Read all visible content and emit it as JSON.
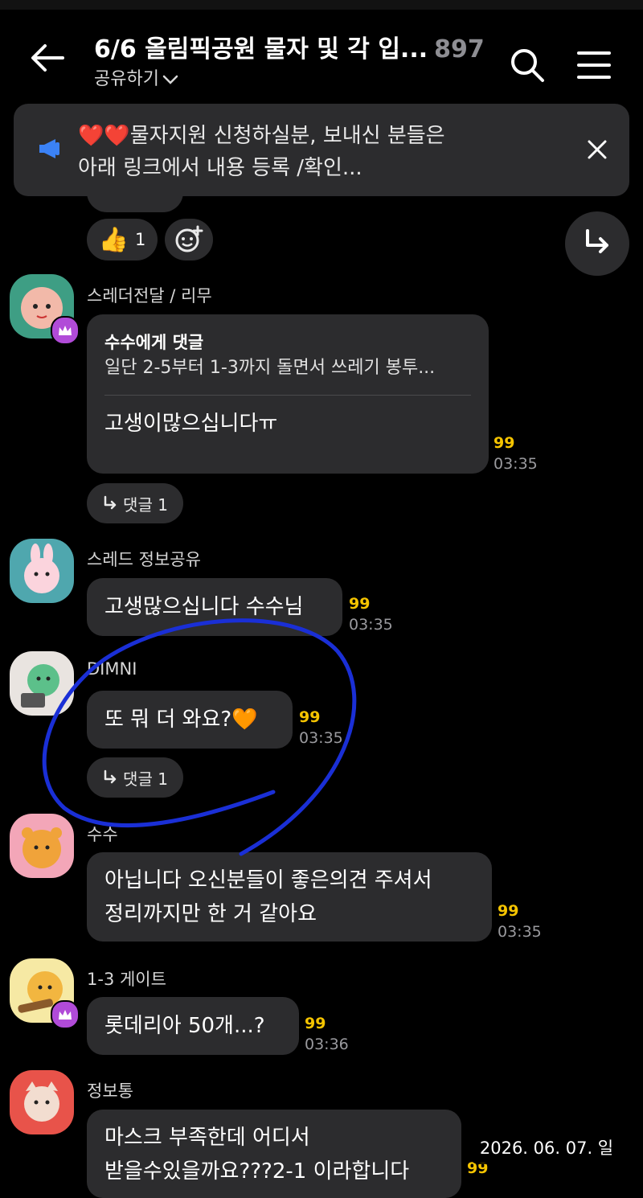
{
  "header": {
    "title": "6/6 올림픽공원 물자 및 각 입...",
    "member_count": "897",
    "share_label": "공유하기"
  },
  "notice": {
    "line1": "❤️❤️물자지원 신청하실분, 보내신 분들은",
    "line2": "아래 링크에서 내용 등록 /확인..."
  },
  "reactions": {
    "thumbs_count": "1"
  },
  "messages": [
    {
      "sender": "스레더전달 / 리무",
      "quote_title": "수수에게 댓글",
      "quote_text": "일단 2-5부터 1-3까지 돌면서 쓰레기 봉투...",
      "text": "고생이많으십니다ㅠ",
      "unread": "99",
      "time": "03:35",
      "reply_label": "댓글 1"
    },
    {
      "sender": "스레드 정보공유",
      "text": "고생많으십니다 수수님",
      "unread": "99",
      "time": "03:35"
    },
    {
      "sender": "DIMNI",
      "text": "또 뭐 더 와요?🧡",
      "unread": "99",
      "time": "03:35",
      "reply_label": "댓글 1"
    },
    {
      "sender": "수수",
      "line1": "아닙니다 오신분들이 좋은의견 주셔서",
      "line2": "정리까지만 한 거 같아요",
      "unread": "99",
      "time": "03:35"
    },
    {
      "sender": "1-3 게이트",
      "text": "롯데리아 50개...?",
      "unread": "99",
      "time": "03:36"
    },
    {
      "sender": "정보통",
      "line1": "마스크 부족한데 어디서",
      "line2": "받을수있을까요???2-1 이라합니다",
      "unread": "99"
    }
  ],
  "date_stamp": "2026. 06. 07. 일",
  "colors": {
    "background": "#000000",
    "bubble": "#2c2c2e",
    "unread": "#f5c400",
    "annotation_circle": "#1a2fd6"
  }
}
